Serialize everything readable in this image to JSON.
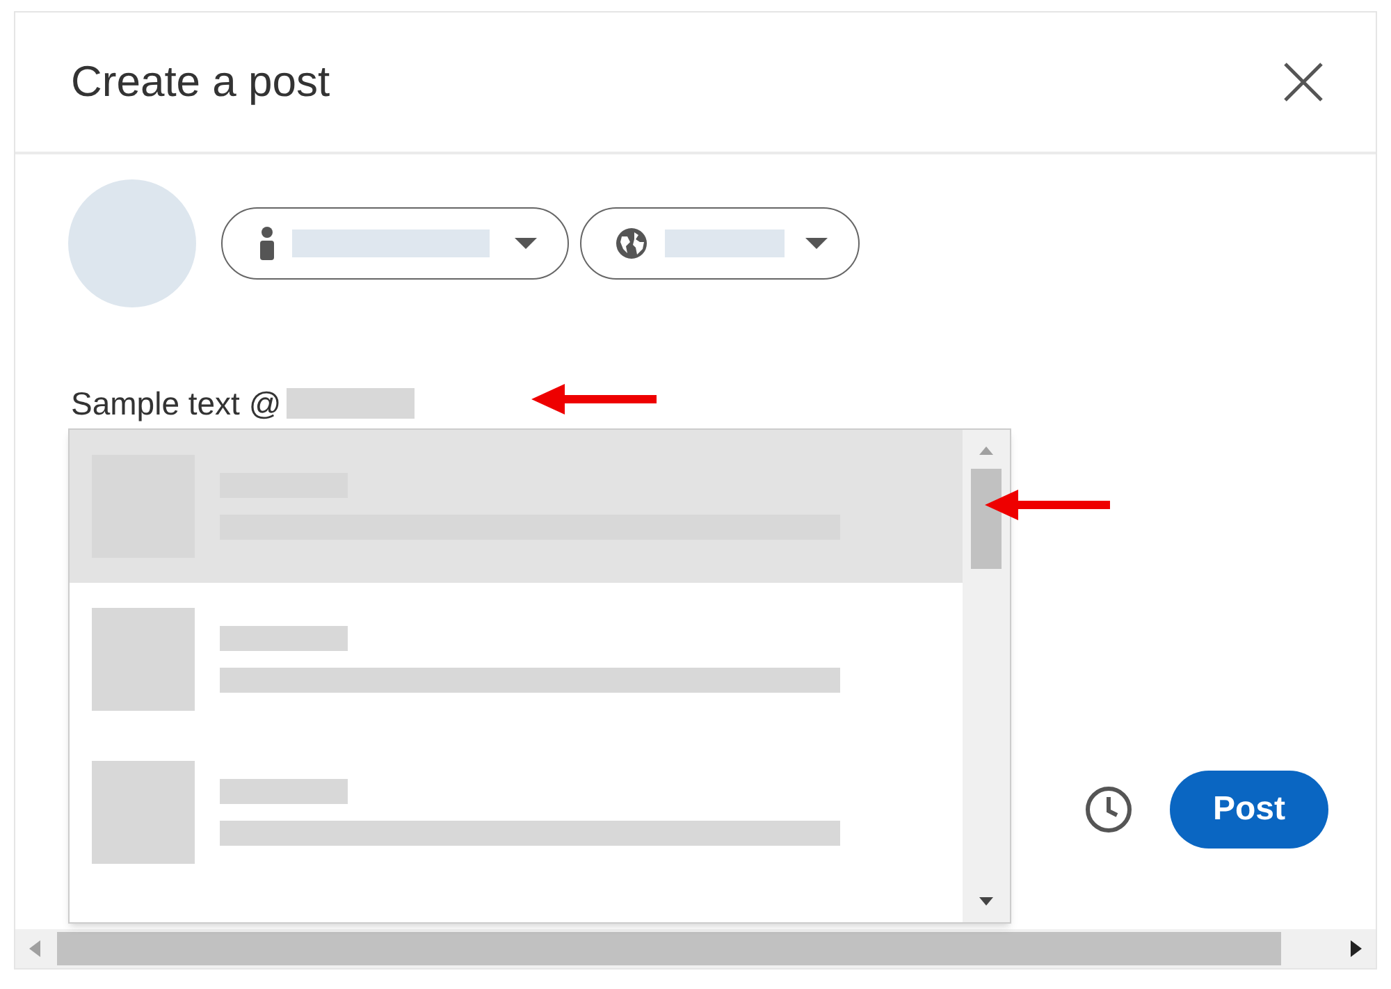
{
  "dialog": {
    "title": "Create a post"
  },
  "composer": {
    "text": "Sample text @"
  },
  "mention_suggestions": [
    {
      "selected": true
    },
    {
      "selected": false
    },
    {
      "selected": false
    }
  ],
  "footer": {
    "post_button": "Post"
  }
}
